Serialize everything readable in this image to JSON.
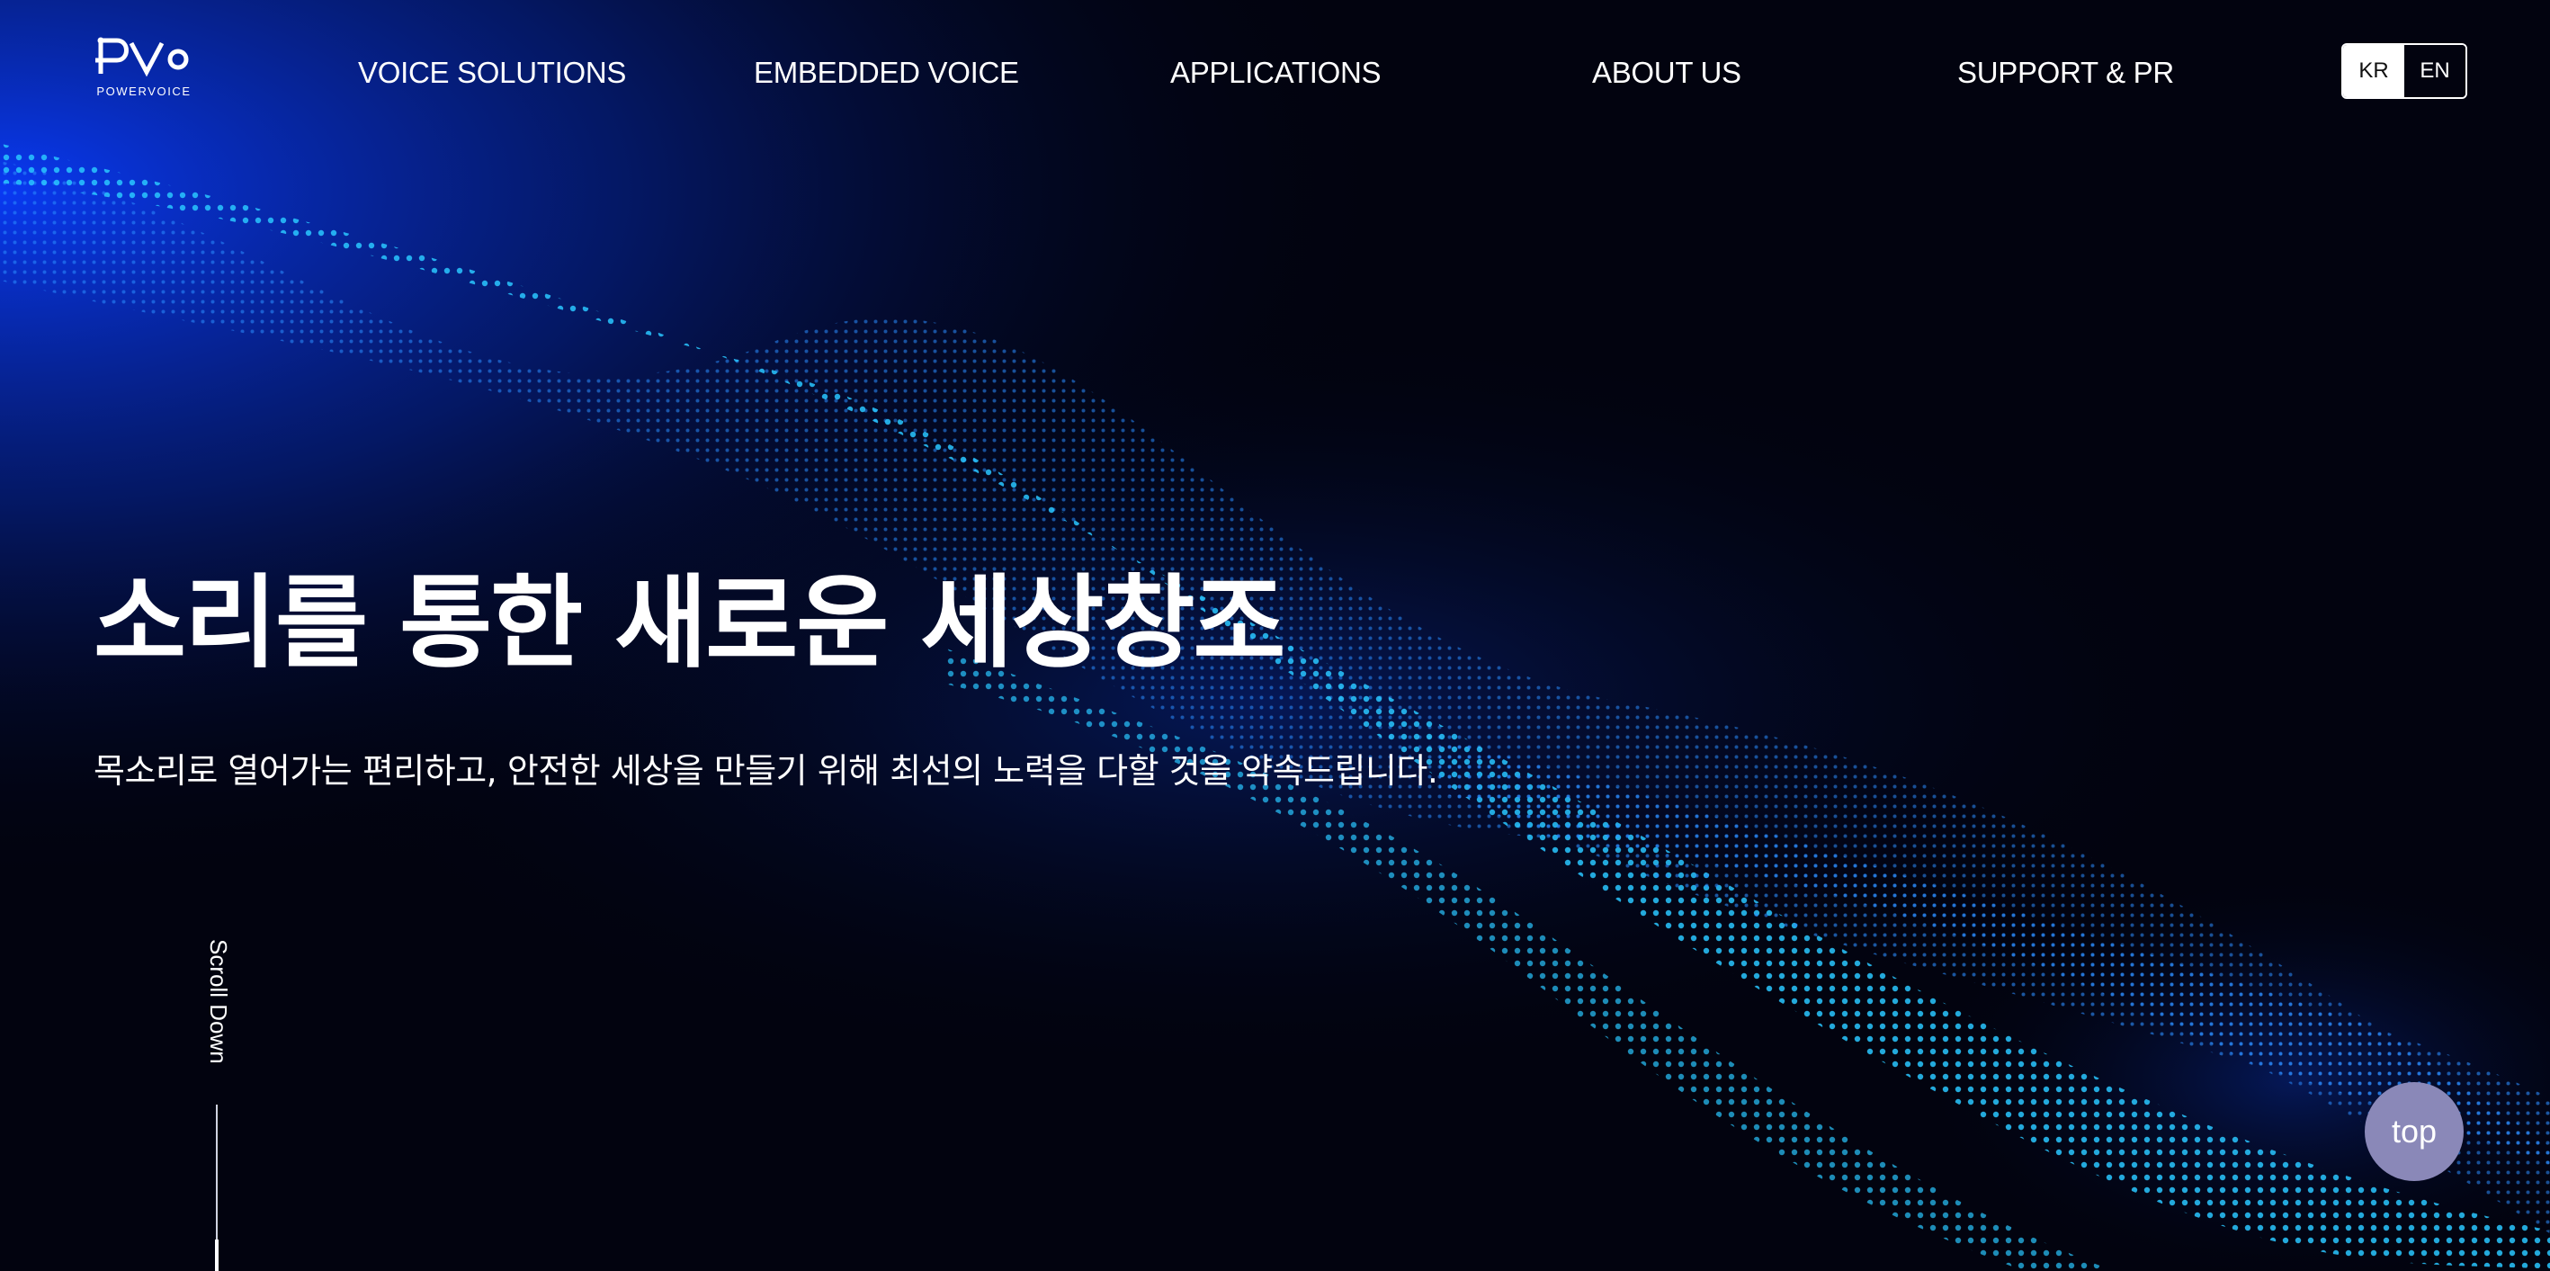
{
  "brand": {
    "logo_text": "PVo",
    "logo_subtext": "POWERVOICE"
  },
  "nav": {
    "items": [
      {
        "label": "VOICE SOLUTIONS"
      },
      {
        "label": "EMBEDDED VOICE"
      },
      {
        "label": "APPLICATIONS"
      },
      {
        "label": "ABOUT US"
      },
      {
        "label": "SUPPORT & PR"
      }
    ]
  },
  "lang": {
    "kr": "KR",
    "en": "EN",
    "selected": "KR"
  },
  "hero": {
    "title": "소리를 통한 새로운 세상창조",
    "subtitle": "목소리로 열어가는 편리하고, 안전한 세상을 만들기 위해 최선의 노력을 다할 것을 약속드립니다."
  },
  "scroll": {
    "label": "Scroll Down"
  },
  "top_button": {
    "label": "top"
  },
  "colors": {
    "background": "#02030f",
    "wave_glow": "#0a3cff",
    "wave_highlight": "#1ee0ff",
    "top_button": "#8a88b8"
  }
}
